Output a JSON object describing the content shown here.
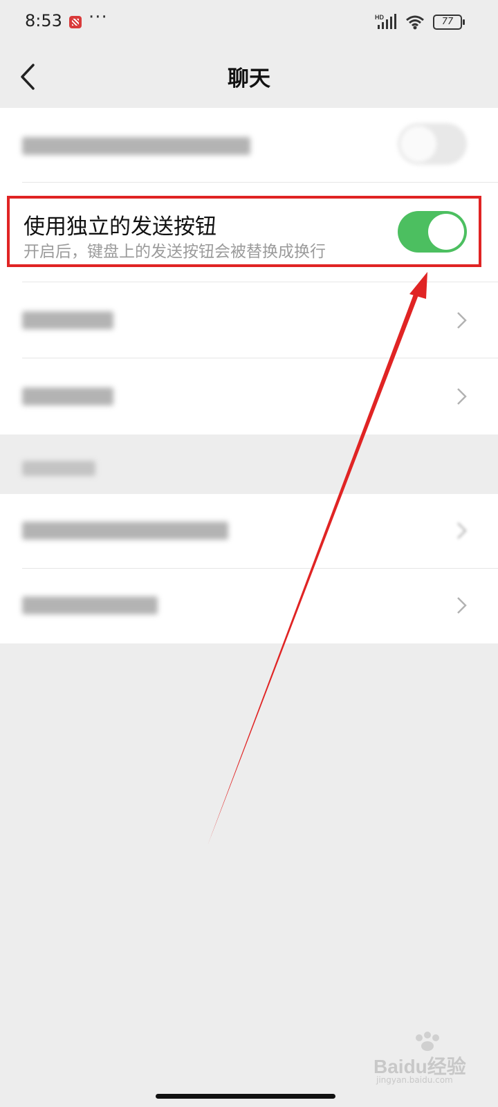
{
  "status_bar": {
    "time": "8:53",
    "more": "···",
    "network_badge": "HD",
    "battery": "77"
  },
  "header": {
    "title": "聊天"
  },
  "settings": {
    "separate_send_button": {
      "label": "使用独立的发送按钮",
      "description": "开启后，键盘上的发送按钮会被替换成换行",
      "enabled": true
    }
  },
  "watermark": {
    "brand": "Baidu",
    "product": "经验",
    "site": "jingyan.baidu.com"
  },
  "colors": {
    "toggle_on": "#4cbf60",
    "highlight": "#e02424",
    "background": "#ededed"
  }
}
